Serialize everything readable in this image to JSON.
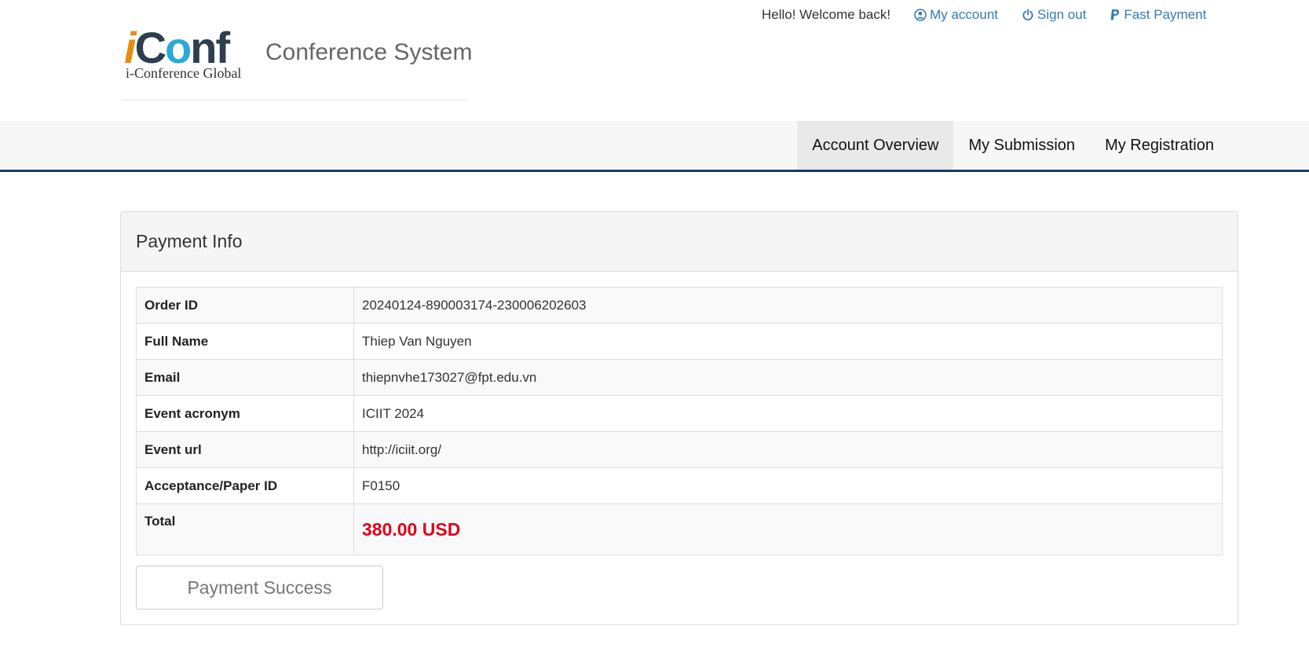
{
  "header": {
    "welcome_text": "Hello! Welcome back!",
    "links": [
      {
        "label": "My account",
        "icon": "user-circle-icon"
      },
      {
        "label": "Sign out",
        "icon": "power-icon"
      },
      {
        "label": "Fast Payment",
        "icon": "paypal-icon"
      }
    ],
    "logo": {
      "word_i": "i",
      "word_c": "C",
      "word_o": "o",
      "word_nf": "nf",
      "subtitle": "i-Conference Global"
    },
    "site_title": "Conference System"
  },
  "nav": {
    "tabs": [
      {
        "label": "Account Overview",
        "active": true
      },
      {
        "label": "My Submission",
        "active": false
      },
      {
        "label": "My Registration",
        "active": false
      }
    ]
  },
  "panel": {
    "title": "Payment Info",
    "rows": [
      {
        "label": "Order ID",
        "value": "20240124-890003174-230006202603"
      },
      {
        "label": "Full Name",
        "value": "Thiep Van Nguyen"
      },
      {
        "label": "Email",
        "value": "thiepnvhe173027@fpt.edu.vn"
      },
      {
        "label": "Event acronym",
        "value": "ICIIT 2024"
      },
      {
        "label": "Event url",
        "value": "http://iciit.org/"
      },
      {
        "label": "Acceptance/Paper ID",
        "value": "F0150"
      }
    ],
    "total": {
      "label": "Total",
      "value": "380.00 USD"
    },
    "status_button": "Payment Success"
  },
  "colors": {
    "link": "#337ab7",
    "total": "#e0001b",
    "navbar_border": "#173d5e",
    "logo_orange": "#e88a12",
    "logo_blue": "#2aa8d8",
    "logo_dark": "#2c3e50"
  }
}
